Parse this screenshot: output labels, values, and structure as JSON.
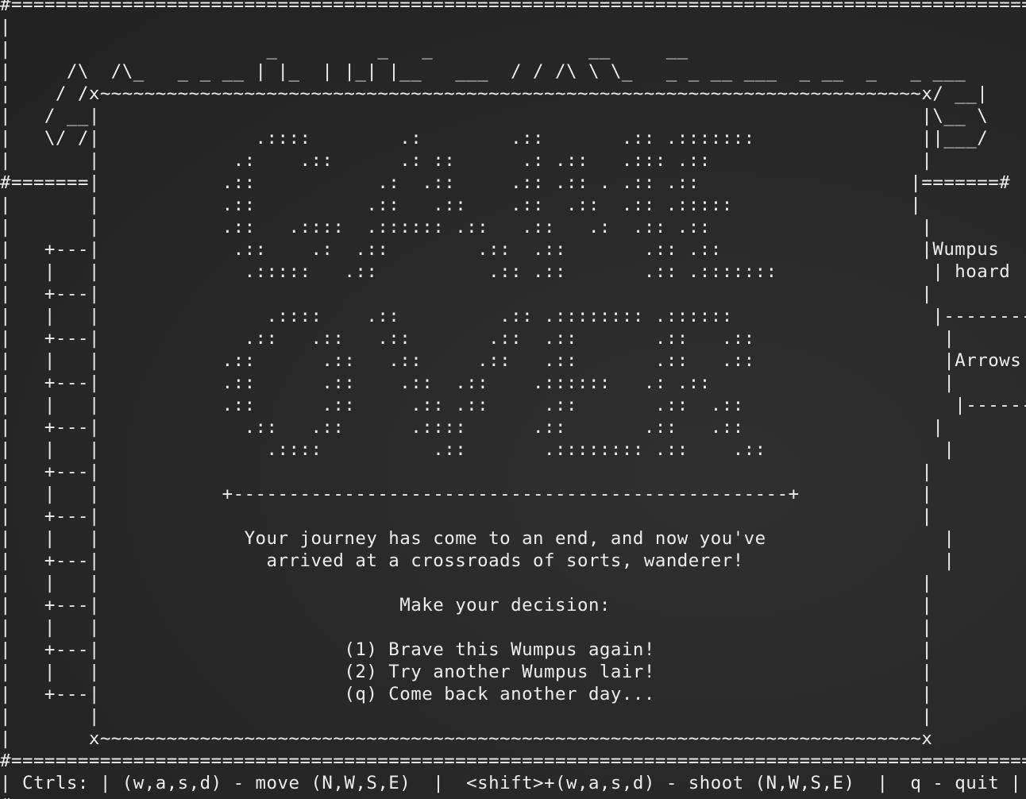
{
  "theme": {
    "background": "#272727",
    "foreground": "#ededed"
  },
  "screen": {
    "lines": [
      "#=============================================================================================#",
      "|                                                                                             |",
      "|                       _         _   _              __     __                                |",
      "|     /\\  /\\_   _ _ __ | |_  | |_| |__   ___  / / /\\ \\ \\_   _ _ __ ___  _ __  _   _ ___     |",
      "|    / /x~~~~~~~~~~~~~~~~~~~~~~~~~~~~~~~~~~~~~~~~~~~~~~~~~~~~~~~~~~~~~~~~~~~~~~~~~~x/ __|     |",
      "|   / __|                                                                          |\\__ \\     |",
      "|   \\/ /|              .::::        .:        .::       .:: .:::::::               ||___/     |",
      "|       |            .:    .::      .: ::      .: .::   .::: .::                   |          |",
      "#=======|           .::           .:  .::     .:: .:: . .:: .::                   |=======#  |",
      "|       |           .::          .::   .::    .::  .::  .:: .:::::                |          |",
      "|       |           .::   .::::  .:::::: .::   .::   .:  .:: .::                   |          |",
      "|   +---|            .::    .:  .::        .::  .::       .:: .::                  |Wumpus    |",
      "|   |   |             .:::::   .::          .:: .::       .:: .:::::::              | hoard     |",
      "|   +---|                                                                          |          |",
      "|   |   |               .::::    .::         .:: .:::::::: .::::::                  |--------  |",
      "|   +---|             .::   .::   .::       .::  .::       .::   .::                 |          |",
      "|   |   |           .::      .::   .::     .::   .::       .::   .::                 |Arrows    |",
      "|   +---|           .::      .::    .::  .::    .::::::   .: .::                     |          |",
      "|   |   |           .::      .::     .:: .::     .::       .::  .::                   |--------  |",
      "|   +---|             .::   .::      .::::      .::       .::   .::                 |          |",
      "|   |   |               .::::          .::       .:::::::: .::    .::                |          |",
      "|   +---|                                                                          |          |",
      "|   |   |           +--------------------------------------------------+           |          |",
      "|   +---|                                                                          |          |",
      "|   |   |             Your journey has come to an end, and now you've                |          |",
      "|   +---|               arrived at a crossroads of sorts, wanderer!                  |          |",
      "|   |   |                                                                          |          |",
      "|   +---|                           Make your decision:                            |          |",
      "|   |   |                                                                          |          |",
      "|   +---|                      (1) Brave this Wumpus again!                        |          |",
      "|   |   |                      (2) Try another Wumpus lair!                        |          |",
      "|   +---|                      (q) Come back another day...                        |          |",
      "|       |                                                                          |          |",
      "|       x~~~~~~~~~~~~~~~~~~~~~~~~~~~~~~~~~~~~~~~~~~~~~~~~~~~~~~~~~~~~~~~~~~~~~~~~~~x          |",
      "#=============================================================================================#",
      "| Ctrls: | (w,a,s,d) - move (N,W,S,E)  |  <shift>+(w,a,s,d) - shoot (N,W,S,E)  |  q - quit |",
      "#=============================================================================================#"
    ]
  }
}
